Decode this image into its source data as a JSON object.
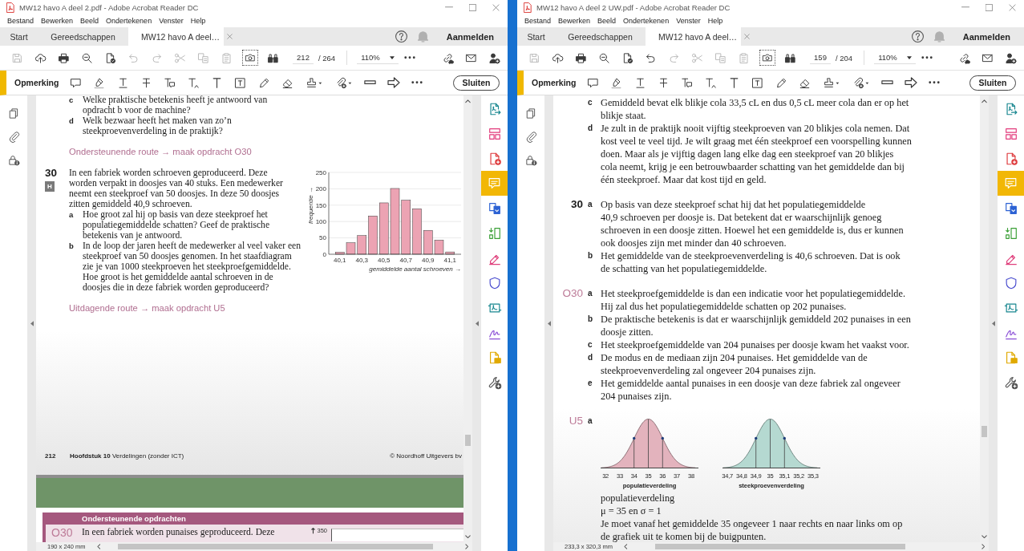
{
  "windows": [
    {
      "title": "MW12 havo A deel 2.pdf - Adobe Acrobat Reader DC",
      "menu": [
        "Bestand",
        "Bewerken",
        "Beeld",
        "Ondertekenen",
        "Venster",
        "Help"
      ],
      "tabs": [
        {
          "label": "Start",
          "selected": false,
          "closable": false
        },
        {
          "label": "Gereedschappen",
          "selected": false,
          "closable": false
        },
        {
          "label": "MW12 havo A deel…",
          "selected": true,
          "closable": true
        }
      ],
      "account": "Aanmelden",
      "toolbar": {
        "tools": [
          {
            "kind": "save",
            "disabled": true,
            "on": false
          },
          {
            "kind": "upload",
            "disabled": false,
            "on": false
          },
          {
            "kind": "print",
            "disabled": false,
            "on": false
          },
          {
            "kind": "zoom_out",
            "disabled": false,
            "on": false
          },
          {
            "kind": "file_check",
            "disabled": false,
            "on": false
          },
          {
            "kind": "undo",
            "disabled": true,
            "on": false
          },
          {
            "kind": "redo",
            "disabled": true,
            "on": false
          },
          {
            "kind": "cut",
            "disabled": true,
            "on": false
          },
          {
            "kind": "copy",
            "disabled": true,
            "on": false
          },
          {
            "kind": "paste",
            "disabled": true,
            "on": false
          },
          {
            "kind": "snapshot",
            "disabled": false,
            "on": true
          },
          {
            "kind": "find",
            "disabled": false,
            "on": false
          }
        ],
        "page": "212",
        "page_total": "/ 264",
        "zoom": "110%",
        "share_tools": [
          {
            "kind": "link"
          },
          {
            "kind": "mail"
          },
          {
            "kind": "share_user"
          }
        ]
      },
      "comment_bar": {
        "label": "Opmerking",
        "tools": [
          {
            "kind": "note"
          },
          {
            "kind": "highlight"
          },
          {
            "kind": "underline"
          },
          {
            "kind": "strikethrough"
          },
          {
            "kind": "replace"
          },
          {
            "kind": "insert"
          },
          {
            "kind": "text"
          },
          {
            "kind": "textbox"
          },
          {
            "kind": "pencil"
          },
          {
            "kind": "eraser"
          },
          {
            "kind": "stamp"
          },
          {
            "kind": "attach"
          },
          {
            "kind": "line"
          },
          {
            "kind": "arrow"
          },
          {
            "kind": "more"
          }
        ],
        "close_button": "Sluiten"
      },
      "side_panel": [
        {
          "kind": "pages"
        },
        {
          "kind": "attachments"
        },
        {
          "kind": "security"
        }
      ],
      "tool_panel": [
        {
          "kind": "export_pdf",
          "selected": false
        },
        {
          "kind": "organize",
          "selected": false
        },
        {
          "kind": "create_pdf",
          "selected": false
        },
        {
          "kind": "comment",
          "selected": true
        },
        {
          "kind": "combine",
          "selected": false
        },
        {
          "kind": "compress",
          "selected": false
        },
        {
          "kind": "fill_sign",
          "selected": false
        },
        {
          "kind": "protect",
          "selected": false
        },
        {
          "kind": "acrobat_sign",
          "selected": false
        },
        {
          "kind": "sign",
          "selected": false
        },
        {
          "kind": "send",
          "selected": false
        },
        {
          "kind": "more_tools",
          "selected": false
        }
      ],
      "document": {
        "blocks": [
          {
            "kind": "items",
            "items": [
              {
                "letter": "c",
                "text": "Welke praktische betekenis heeft je antwoord van opdracht b voor de machine?"
              },
              {
                "letter": "d",
                "text": "Welk bezwaar heeft het maken van zo’n steekproevenverdeling in de praktijk?"
              }
            ]
          },
          {
            "kind": "route",
            "text": "Ondersteunende route → maak opdracht O30"
          },
          {
            "kind": "exercise",
            "number": "30",
            "badge": "H",
            "text": "In een fabriek worden schroeven geproduceerd. Deze worden verpakt in doosjes van 40 stuks. Een medewerker neemt een steekproef van 50 doosjes. In deze 50 doosjes zitten gemiddeld 40,9 schroeven.",
            "items": [
              {
                "letter": "a",
                "text": "Hoe groot zal hij op basis van deze steekproef het populatiegemiddelde schatten? Geef de praktische betekenis van je antwoord."
              },
              {
                "letter": "b",
                "text": "In de loop der jaren heeft de medewerker al veel vaker een steekproef van 50 doosjes genomen. In het staafdiagram zie je van 1000 steekproeven het steekproefgemiddelde. Hoe groot is het gemiddelde aantal schroeven in de doosjes die in deze fabriek worden geproduceerd?"
              }
            ],
            "chart_data": {
              "type": "bar",
              "xlabel": "gemiddelde aantal schroeven →",
              "ylabel": "frequentie →",
              "x": [
                40.1,
                40.2,
                40.3,
                40.4,
                40.5,
                40.6,
                40.7,
                40.8,
                40.9,
                41.0,
                41.1
              ],
              "values": [
                6,
                35,
                57,
                117,
                157,
                201,
                165,
                139,
                73,
                43,
                7
              ],
              "xlim": [
                40.0,
                41.2
              ],
              "ylim": [
                0,
                250
              ],
              "yticks": [
                0,
                50,
                100,
                150,
                200,
                250
              ],
              "xticks": [
                {
                  "value": 40.1,
                  "label": "40,1"
                },
                {
                  "value": 40.3,
                  "label": "40,3"
                },
                {
                  "value": 40.5,
                  "label": "40,5"
                },
                {
                  "value": 40.7,
                  "label": "40,7"
                },
                {
                  "value": 40.9,
                  "label": "40,9"
                },
                {
                  "value": 41.1,
                  "label": "41,1"
                }
              ],
              "grid": true
            }
          },
          {
            "kind": "route",
            "text": "Uitdagende route → maak opdracht U5"
          },
          {
            "kind": "footer",
            "page": "212",
            "chapter": "**Hoofdstuk 10** Verdelingen (zonder ICT)",
            "publisher": "© Noordhoff Uitgevers bv"
          }
        ],
        "next_page": {
          "section": "Ondersteunende opdrachten",
          "number": "O30",
          "text": "In een fabriek worden punaises geproduceerd. Deze",
          "axis_tick": "350"
        }
      },
      "status": {
        "page_size": "190 x 240 mm"
      }
    },
    {
      "title": "MW12 havo A deel 2 UW.pdf - Adobe Acrobat Reader DC",
      "menu": [
        "Bestand",
        "Bewerken",
        "Beeld",
        "Ondertekenen",
        "Venster",
        "Help"
      ],
      "tabs": [
        {
          "label": "Start",
          "selected": false,
          "closable": false
        },
        {
          "label": "Gereedschappen",
          "selected": false,
          "closable": false
        },
        {
          "label": "MW12 havo A deel…",
          "selected": true,
          "closable": true
        }
      ],
      "account": "Aanmelden",
      "toolbar": {
        "tools": [
          {
            "kind": "save",
            "disabled": true,
            "on": false
          },
          {
            "kind": "upload",
            "disabled": false,
            "on": false
          },
          {
            "kind": "print",
            "disabled": false,
            "on": false
          },
          {
            "kind": "zoom_out",
            "disabled": false,
            "on": false
          },
          {
            "kind": "file_check",
            "disabled": false,
            "on": false
          },
          {
            "kind": "undo",
            "disabled": false,
            "on": false
          },
          {
            "kind": "redo",
            "disabled": true,
            "on": false
          },
          {
            "kind": "cut",
            "disabled": true,
            "on": false
          },
          {
            "kind": "copy",
            "disabled": true,
            "on": false
          },
          {
            "kind": "paste",
            "disabled": true,
            "on": false
          },
          {
            "kind": "snapshot",
            "disabled": false,
            "on": true
          },
          {
            "kind": "find",
            "disabled": false,
            "on": false
          }
        ],
        "page": "159",
        "page_total": "/ 204",
        "zoom": "110%",
        "share_tools": [
          {
            "kind": "link"
          },
          {
            "kind": "mail"
          },
          {
            "kind": "share_user"
          }
        ]
      },
      "comment_bar": {
        "label": "Opmerking",
        "tools": [
          {
            "kind": "note"
          },
          {
            "kind": "highlight"
          },
          {
            "kind": "underline"
          },
          {
            "kind": "strikethrough"
          },
          {
            "kind": "replace"
          },
          {
            "kind": "insert"
          },
          {
            "kind": "text"
          },
          {
            "kind": "textbox"
          },
          {
            "kind": "pencil"
          },
          {
            "kind": "eraser"
          },
          {
            "kind": "stamp"
          },
          {
            "kind": "attach"
          },
          {
            "kind": "line"
          },
          {
            "kind": "arrow"
          },
          {
            "kind": "more"
          }
        ],
        "close_button": "Sluiten"
      },
      "side_panel": [
        {
          "kind": "pages"
        },
        {
          "kind": "attachments"
        },
        {
          "kind": "security"
        }
      ],
      "tool_panel": [
        {
          "kind": "export_pdf",
          "selected": false
        },
        {
          "kind": "organize",
          "selected": false
        },
        {
          "kind": "create_pdf",
          "selected": false
        },
        {
          "kind": "comment",
          "selected": true
        },
        {
          "kind": "combine",
          "selected": false
        },
        {
          "kind": "compress",
          "selected": false
        },
        {
          "kind": "fill_sign",
          "selected": false
        },
        {
          "kind": "protect",
          "selected": false
        },
        {
          "kind": "acrobat_sign",
          "selected": false
        },
        {
          "kind": "sign",
          "selected": false
        },
        {
          "kind": "send",
          "selected": false
        },
        {
          "kind": "more_tools",
          "selected": false
        }
      ],
      "document": {
        "blocks": [
          {
            "kind": "items",
            "items": [
              {
                "letter": "c",
                "text": "Gemiddeld bevat elk blikje cola 33,5 cL en dus 0,5 cL meer cola dan er op het blikje staat."
              },
              {
                "letter": "d",
                "text": "Je zult in de praktijk nooit vijftig steekproeven van 20 blikjes cola nemen. Dat kost veel te veel tijd. Je wilt graag met één steekproef een voorspelling kunnen doen. Maar als je vijftig dagen lang elke dag een steekproef van 20 blikjes cola neemt, krijg je een betrouwbaarder schatting van het gemiddelde dan bij één steekproef. Maar dat kost tijd en geld."
              }
            ]
          },
          {
            "kind": "answer",
            "number": "30",
            "items": [
              {
                "letter": "a",
                "text": "Op basis van deze steekproef schat hij dat het populatiegemiddelde 40,9 schroeven per doosje is. Dat betekent dat er waarschijnlijk genoeg schroeven in een doosje zitten. Hoewel het een gemiddelde is, dus er kunnen ook doosjes zijn met minder dan 40 schroeven."
              },
              {
                "letter": "b",
                "text": "Het gemiddelde van de steekproevenverdeling is 40,6 schroeven. Dat is ook de schatting van het populatiegemiddelde."
              }
            ]
          },
          {
            "kind": "extra_answer",
            "number": "O30",
            "items": [
              {
                "letter": "a",
                "text": "Het steekproefgemiddelde is dan een indicatie voor het populatiegemiddelde. Hij zal dus het populatiegemiddelde schatten op 202 punaises."
              },
              {
                "letter": "b",
                "text": "De praktische betekenis is dat er waarschijnlijk gemiddeld 202 punaises in een doosje zitten."
              },
              {
                "letter": "c",
                "text": "Het steekproefgemiddelde van 204 punaises per doosje kwam het vaakst voor."
              },
              {
                "letter": "d",
                "text": "De modus en de mediaan zijn 204 punaises. Het gemiddelde van de steekproevenverdeling zal ongeveer 204 punaises zijn."
              },
              {
                "letter": "e",
                "text": "Het gemiddelde aantal punaises in een doosje van deze fabriek zal ongeveer 204 punaises zijn."
              }
            ]
          },
          {
            "kind": "extra_answer",
            "number": "U5",
            "items": [
              {
                "letter": "a",
                "figures": [
                  {
                    "ticks": [
                      "32",
                      "33",
                      "34",
                      "35",
                      "36",
                      "37",
                      "38"
                    ],
                    "caption": "populatieverdeling",
                    "color": "#e3b3bd"
                  },
                  {
                    "ticks": [
                      "34,7",
                      "34,8",
                      "34,9",
                      "35",
                      "35,1",
                      "35,2",
                      "35,3"
                    ],
                    "caption": "steekproevenverdeling",
                    "color": "#b5d9d1"
                  }
                ],
                "paragraphs": [
                  "populatieverdeling",
                  "μ = 35 en σ = 1",
                  "Je moet vanaf het gemiddelde 35 ongeveer 1 naar rechts en naar links om op de grafiek uit te komen bij de buigpunten."
                ]
              }
            ]
          }
        ]
      },
      "status": {
        "page_size": "233,3 x 320,3 mm"
      }
    }
  ]
}
